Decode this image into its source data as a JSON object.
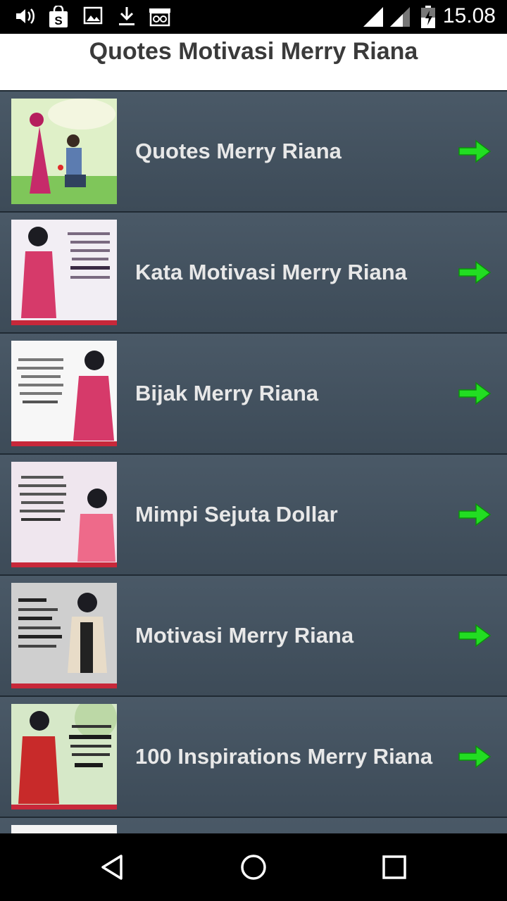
{
  "status_bar": {
    "time": "15.08"
  },
  "header": {
    "title": "Quotes Motivasi Merry Riana"
  },
  "list": {
    "items": [
      {
        "label": "Quotes Merry Riana",
        "thumb": "cartoon-couple-thumbnail"
      },
      {
        "label": "Kata Motivasi Merry Riana",
        "thumb": "quote-card-thumbnail"
      },
      {
        "label": "Bijak Merry Riana",
        "thumb": "quote-card-thumbnail"
      },
      {
        "label": "Mimpi Sejuta Dollar",
        "thumb": "quote-card-thumbnail"
      },
      {
        "label": "Motivasi Merry Riana",
        "thumb": "quote-card-thumbnail"
      },
      {
        "label": "100 Inspirations Merry Riana",
        "thumb": "quote-card-thumbnail"
      }
    ]
  },
  "colors": {
    "arrow": "#22dd22",
    "list_bg": "#3f4d5a",
    "header_text": "#3a3a3a"
  }
}
